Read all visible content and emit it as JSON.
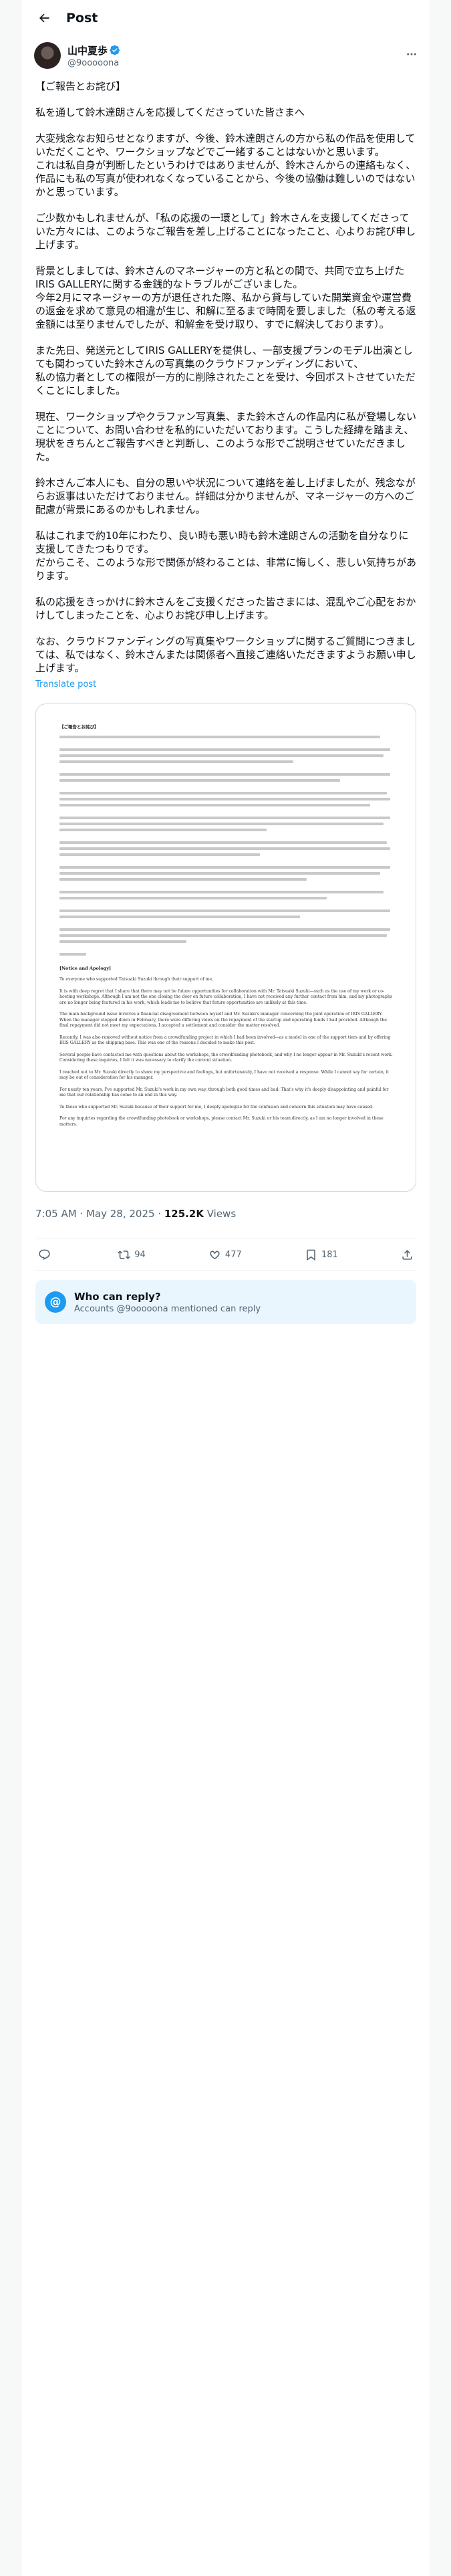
{
  "header": {
    "title": "Post"
  },
  "author": {
    "name": "山中夏歩",
    "handle": "@9ooooona"
  },
  "paragraphs": [
    "【ご報告とお詫び】",
    "私を通して鈴木達朗さんを応援してくださっていた皆さまへ",
    "大変残念なお知らせとなりますが、今後、鈴木達朗さんの方から私の作品を使用していただくことや、ワークショップなどでご一緒することはないかと思います。\nこれは私自身が判断したというわけではありませんが、鈴木さんからの連絡もなく、作品にも私の写真が使われなくなっていることから、今後の協働は難しいのではないかと思っています。",
    "ご少数かもしれませんが、「私の応援の一環として」鈴木さんを支援してくださっていた方々には、このようなご報告を差し上げることになったこと、心よりお詫び申し上げます。",
    "背景としましては、鈴木さんのマネージャーの方と私との間で、共同で立ち上げたIRIS GALLERYに関する金銭的なトラブルがございました。\n今年2月にマネージャーの方が退任された際、私から貸与していた開業資金や運営費の返金を求めて意見の相違が生じ、和解に至るまで時間を要しました（私の考える返金額には至りませんでしたが、和解金を受け取り、すでに解決しております）。",
    "また先日、発送元としてIRIS GALLERYを提供し、一部支援プランのモデル出演としても関わっていた鈴木さんの写真集のクラウドファンディングにおいて、\n私の協力者としての権限が一方的に削除されたことを受け、今回ポストさせていただくことにしました。",
    "現在、ワークショップやクラファン写真集、また鈴木さんの作品内に私が登場しないことについて、お問い合わせを私的にいただいております。こうした経緯を踏まえ、現状をきちんとご報告すべきと判断し、このような形でご説明させていただきました。",
    "鈴木さんご本人にも、自分の思いや状況について連絡を差し上げましたが、残念ながらお返事はいただけておりません。詳細は分かりませんが、マネージャーの方へのご配慮が背景にあるのかもしれません。",
    "私はこれまで約10年にわたり、良い時も悪い時も鈴木達朗さんの活動を自分なりに支援してきたつもりです。\nだからこそ、このような形で関係が終わることは、非常に悔しく、悲しい気持ちがあります。",
    "私の応援をきっかけに鈴木さんをご支援くださった皆さまには、混乱やご心配をおかけしてしまったことを、心よりお詫び申し上げます。",
    "なお、クラウドファンディングの写真集やワークショップに関するご質問につきましては、私ではなく、鈴木さんまたは関係者へ直接ご連絡いただきますようお願い申し上げます。"
  ],
  "translate_label": "Translate post",
  "image_doc": {
    "heading_jp": "【ご報告とお詫び】",
    "heading_en": "[Notice and Apology]",
    "en_paragraphs": [
      "To everyone who supported Tatsuaki Suzuki through their support of me,",
      "It is with deep regret that I share that there may not be future opportunities for collaboration with Mr. Tatsuaki Suzuki—such as the use of my work or co-hosting workshops. Although I am not the one closing the door on future collaboration, I have not received any further contact from him, and my photographs are no longer being featured in his work, which leads me to believe that future opportunities are unlikely at this time.",
      "The main background issue involves a financial disagreement between myself and Mr. Suzuki's manager concerning the joint operation of IRIS GALLERY. When the manager stepped down in February, there were differing views on the repayment of the startup and operating funds I had provided. Although the final repayment did not meet my expectations, I accepted a settlement and consider the matter resolved.",
      "Recently, I was also removed without notice from a crowdfunding project in which I had been involved—as a model in one of the support tiers and by offering IRIS GALLERY as the shipping base. This was one of the reasons I decided to make this post.",
      "Several people have contacted me with questions about the workshops, the crowdfunding photobook, and why I no longer appear in Mr. Suzuki's recent work. Considering these inquiries, I felt it was necessary to clarify the current situation.",
      "I reached out to Mr. Suzuki directly to share my perspective and feelings, but unfortunately, I have not received a response. While I cannot say for certain, it may be out of consideration for his manager.",
      "For nearly ten years, I've supported Mr. Suzuki's work in my own way, through both good times and bad. That's why it's deeply disappointing and painful for me that our relationship has come to an end in this way.",
      "To those who supported Mr. Suzuki because of their support for me, I deeply apologize for the confusion and concern this situation may have caused.",
      "For any inquiries regarding the crowdfunding photobook or workshops, please contact Mr. Suzuki or his team directly, as I am no longer involved in these matters."
    ]
  },
  "meta": {
    "time": "7:05 AM · May 28, 2025",
    "views_count": "125.2K",
    "views_label": "Views"
  },
  "actions": {
    "replies": "",
    "reposts": "94",
    "likes": "477",
    "bookmarks": "181"
  },
  "reply_restriction": {
    "title": "Who can reply?",
    "subtitle": "Accounts @9ooooona mentioned can reply"
  },
  "colors": {
    "accent": "#1d9bf0",
    "text": "#0f1419",
    "muted": "#536471",
    "border": "#cfd9de",
    "reply_bg": "#eaf6fe"
  }
}
